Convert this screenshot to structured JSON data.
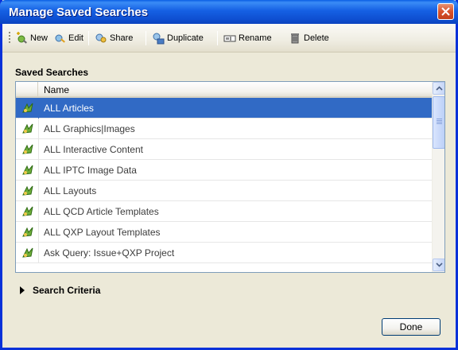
{
  "window": {
    "title": "Manage Saved Searches",
    "accent": "#0e4fd1",
    "selection_color": "#316ac5"
  },
  "toolbar": {
    "items": [
      {
        "label": "New",
        "icon": "new-search-icon"
      },
      {
        "label": "Edit",
        "icon": "edit-search-icon"
      },
      {
        "label": "Share",
        "icon": "share-icon"
      },
      {
        "label": "Duplicate",
        "icon": "duplicate-icon"
      },
      {
        "label": "Rename",
        "icon": "rename-icon"
      },
      {
        "label": "Delete",
        "icon": "trash-icon"
      }
    ]
  },
  "list": {
    "section_label": "Saved Searches",
    "column_header": "Name",
    "selected_index": 0,
    "rows": [
      {
        "name": "ALL Articles",
        "icon": "saved-search-icon"
      },
      {
        "name": "ALL Graphics|Images",
        "icon": "saved-search-icon"
      },
      {
        "name": "ALL Interactive Content",
        "icon": "saved-search-icon"
      },
      {
        "name": "ALL IPTC Image Data",
        "icon": "saved-search-icon"
      },
      {
        "name": "ALL Layouts",
        "icon": "saved-search-icon"
      },
      {
        "name": "ALL QCD Article Templates",
        "icon": "saved-search-icon"
      },
      {
        "name": "ALL QXP Layout Templates",
        "icon": "saved-search-icon"
      },
      {
        "name": "Ask Query: Issue+QXP Project",
        "icon": "saved-search-icon"
      }
    ]
  },
  "criteria": {
    "label": "Search Criteria",
    "expanded": false
  },
  "footer": {
    "done_label": "Done"
  }
}
